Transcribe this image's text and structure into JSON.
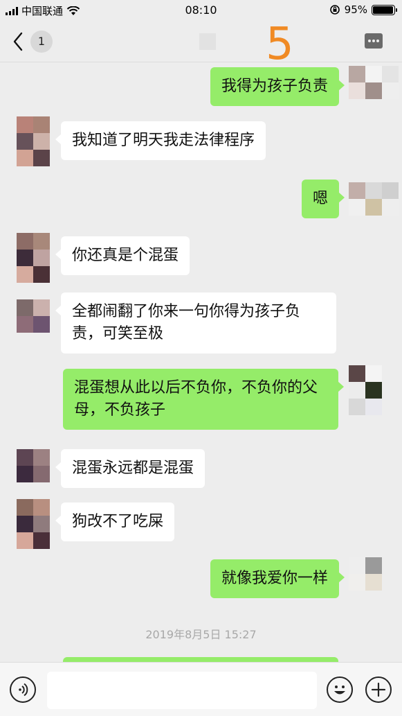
{
  "status_bar": {
    "carrier": "中国联通",
    "time": "08:10",
    "battery": "95%",
    "battery_level": 0.95
  },
  "nav": {
    "unread_count": "1",
    "overlay_number": "5"
  },
  "messages": [
    {
      "side": "out",
      "text": "我得为孩子负责"
    },
    {
      "side": "in",
      "text": "我知道了明天我走法律程序"
    },
    {
      "side": "out",
      "text": "嗯"
    },
    {
      "side": "in",
      "text": "你还真是个混蛋"
    },
    {
      "side": "in",
      "text": "全都闹翻了你来一句你得为孩子负责，可笑至极"
    },
    {
      "side": "out",
      "text": "混蛋想从此以后不负你，不负你的父母，不负孩子"
    },
    {
      "side": "in",
      "text": "混蛋永远都是混蛋"
    },
    {
      "side": "in",
      "text": "狗改不了吃屎"
    },
    {
      "side": "out",
      "text": "就像我爱你一样"
    }
  ],
  "timestamp": "2019年8月5日 15:27",
  "input_bar": {
    "placeholder": ""
  },
  "colors": {
    "outgoing_bubble": "#95ec69",
    "incoming_bubble": "#ffffff",
    "background": "#ededed",
    "overlay_number": "#f08a24"
  },
  "icons": [
    "wifi-icon",
    "orientation-lock-icon",
    "back-chevron-icon",
    "more-icon",
    "voice-icon",
    "emoji-icon",
    "add-icon"
  ]
}
